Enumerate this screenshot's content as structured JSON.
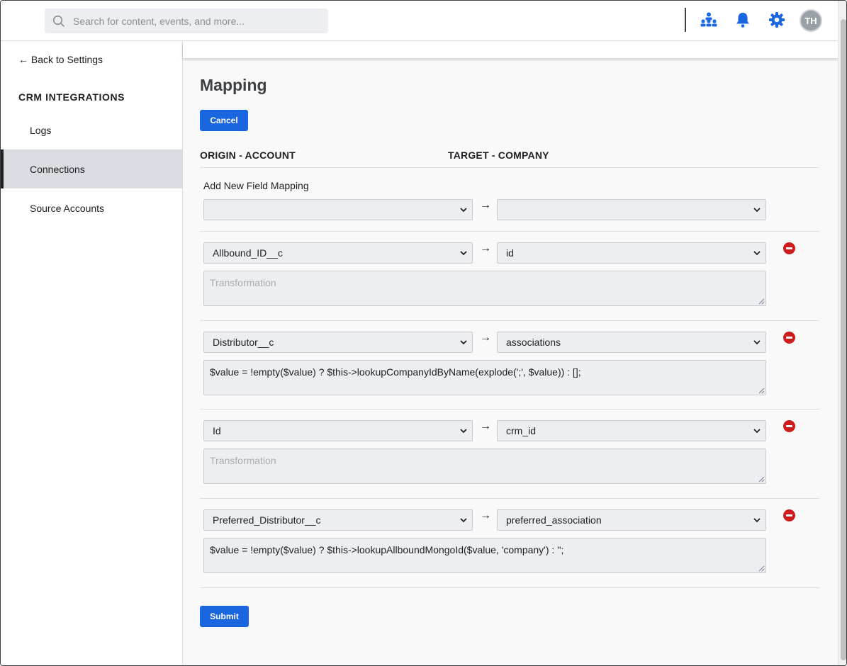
{
  "header": {
    "search_placeholder": "Search for content, events, and more...",
    "avatar_initials": "TH"
  },
  "sidebar": {
    "back_label": "← Back to Settings",
    "section_title": "CRM INTEGRATIONS",
    "items": [
      {
        "label": "Logs",
        "active": false
      },
      {
        "label": "Connections",
        "active": true
      },
      {
        "label": "Source Accounts",
        "active": false
      }
    ]
  },
  "main": {
    "title": "Mapping",
    "cancel_label": "Cancel",
    "submit_label": "Submit",
    "origin_header": "ORIGIN - ACCOUNT",
    "target_header": "TARGET - COMPANY",
    "add_label": "Add New Field Mapping",
    "arrow": "→",
    "new_mapping": {
      "origin": "",
      "target": ""
    },
    "mappings": [
      {
        "origin": "Allbound_ID__c",
        "target": "id",
        "transformation": "",
        "placeholder": "Transformation"
      },
      {
        "origin": "Distributor__c",
        "target": "associations",
        "transformation": "$value = !empty($value) ? $this->lookupCompanyIdByName(explode(';', $value)) : [];",
        "placeholder": "Transformation"
      },
      {
        "origin": "Id",
        "target": "crm_id",
        "transformation": "",
        "placeholder": "Transformation"
      },
      {
        "origin": "Preferred_Distributor__c",
        "target": "preferred_association",
        "transformation": "$value = !empty($value) ? $this->lookupAllboundMongoId($value, 'company') : '';",
        "placeholder": "Transformation"
      }
    ]
  },
  "colors": {
    "primary": "#1a66e0",
    "danger": "#cc1c1c",
    "icon_blue": "#1a66e0"
  }
}
